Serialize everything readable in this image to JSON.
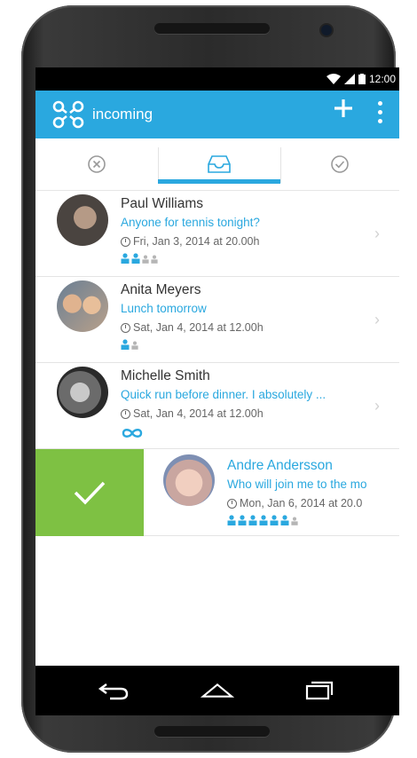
{
  "status": {
    "time": "12:00"
  },
  "appbar": {
    "title": "incoming"
  },
  "tabs": [
    {
      "name": "declined",
      "icon": "x-circle-icon"
    },
    {
      "name": "incoming",
      "icon": "inbox-icon"
    },
    {
      "name": "accepted",
      "icon": "check-circle-icon"
    }
  ],
  "events": [
    {
      "name": "Paul Williams",
      "message": "Anyone for tennis tonight?",
      "datetime": "Fri, Jan 3, 2014 at 20.00h",
      "attendees_confirmed": 2,
      "attendees_total": 4
    },
    {
      "name": "Anita Meyers",
      "message": "Lunch tomorrow",
      "datetime": "Sat, Jan 4, 2014 at 12.00h",
      "attendees_confirmed": 1,
      "attendees_total": 2
    },
    {
      "name": "Michelle Smith",
      "message": "Quick run before dinner. I absolutely ...",
      "datetime": "Sat, Jan 4, 2014 at 12.00h",
      "attendees": "unlimited"
    },
    {
      "name": "Andre Andersson",
      "message": "Who will join me to the mo",
      "datetime": "Mon, Jan 6, 2014 at 20.0",
      "attendees_confirmed": 6,
      "attendees_total": 7,
      "swiped": true
    }
  ],
  "colors": {
    "accent": "#2aa8df",
    "accept": "#7ec143"
  }
}
